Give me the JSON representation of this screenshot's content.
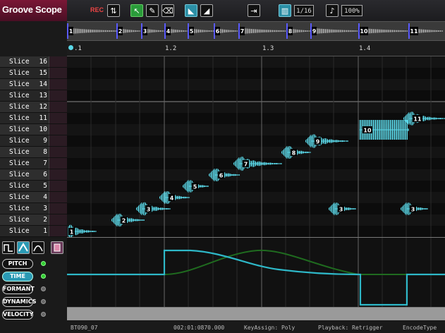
{
  "app": {
    "logo": "Groove Scope"
  },
  "toolbar": {
    "rec_label": "REC",
    "quantize": "1/16",
    "percent": "100%"
  },
  "overview": {
    "slices": [
      "1",
      "2",
      "3",
      "4",
      "5",
      "6",
      "7",
      "8",
      "9",
      "10",
      "11"
    ]
  },
  "ruler": {
    "ticks": [
      ".1",
      "1.2",
      "1.3",
      "1.4"
    ]
  },
  "slice_list": [
    {
      "name": "Slice",
      "num": "16"
    },
    {
      "name": "Slice",
      "num": "15"
    },
    {
      "name": "Slice",
      "num": "14"
    },
    {
      "name": "Slice",
      "num": "13"
    },
    {
      "name": "Slice",
      "num": "12"
    },
    {
      "name": "Slice",
      "num": "11"
    },
    {
      "name": "Slice",
      "num": "10"
    },
    {
      "name": "Slice",
      "num": "9"
    },
    {
      "name": "Slice",
      "num": "8"
    },
    {
      "name": "Slice",
      "num": "7"
    },
    {
      "name": "Slice",
      "num": "6"
    },
    {
      "name": "Slice",
      "num": "5"
    },
    {
      "name": "Slice",
      "num": "4"
    },
    {
      "name": "Slice",
      "num": "3"
    },
    {
      "name": "Slice",
      "num": "2"
    },
    {
      "name": "Slice",
      "num": "1"
    }
  ],
  "grid_slices": [
    {
      "label": "1",
      "slice": 1
    },
    {
      "label": "2",
      "slice": 2
    },
    {
      "label": "3",
      "slice": 3
    },
    {
      "label": "4",
      "slice": 4
    },
    {
      "label": "5",
      "slice": 5
    },
    {
      "label": "6",
      "slice": 6
    },
    {
      "label": "7",
      "slice": 7
    },
    {
      "label": "8",
      "slice": 8
    },
    {
      "label": "9",
      "slice": 9
    },
    {
      "label": "10",
      "slice": 10
    },
    {
      "label": "11",
      "slice": 11
    },
    {
      "label": "3",
      "slice": 3
    },
    {
      "label": "3",
      "slice": 3
    }
  ],
  "params": {
    "pitch": "PITCH",
    "time": "TIME",
    "formant": "FORMANT",
    "dynamics": "DYNAMICS",
    "velocity": "VELOCITY"
  },
  "status": {
    "file": "BT090_07",
    "position": "002:01:0870.000",
    "keyassign": "KeyAssign: Poly",
    "playback": "Playback: Retrigger",
    "encode": "EncodeType"
  },
  "colors": {
    "accent": "#5ad8e8",
    "logo_bg": "#7a1736",
    "env_line": "#2eb8c8",
    "env_line2": "#1f6b1f"
  }
}
